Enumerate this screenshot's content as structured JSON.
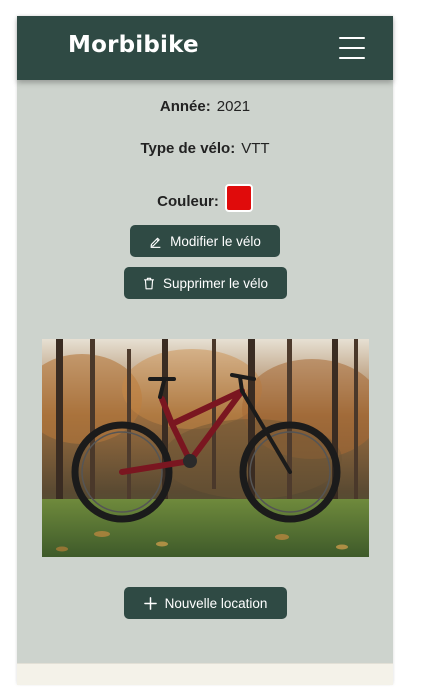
{
  "app": {
    "brand": "Morbibike"
  },
  "details": {
    "year_label": "Année:",
    "year_value": "2021",
    "type_label": "Type de vélo:",
    "type_value": "VTT",
    "color_label": "Couleur:",
    "color_value": "#e00b0b"
  },
  "actions": {
    "edit_label": "Modifier le vélo",
    "delete_label": "Supprimer le vélo",
    "new_rental_label": "Nouvelle location"
  },
  "icons": {
    "menu": "hamburger-menu-icon",
    "edit": "pencil-icon",
    "delete": "trash-icon",
    "add": "plus-icon"
  },
  "colors": {
    "primary": "#2f4a44",
    "page_bg": "#cdd3cd",
    "footer_bg": "#f4f2e9"
  }
}
